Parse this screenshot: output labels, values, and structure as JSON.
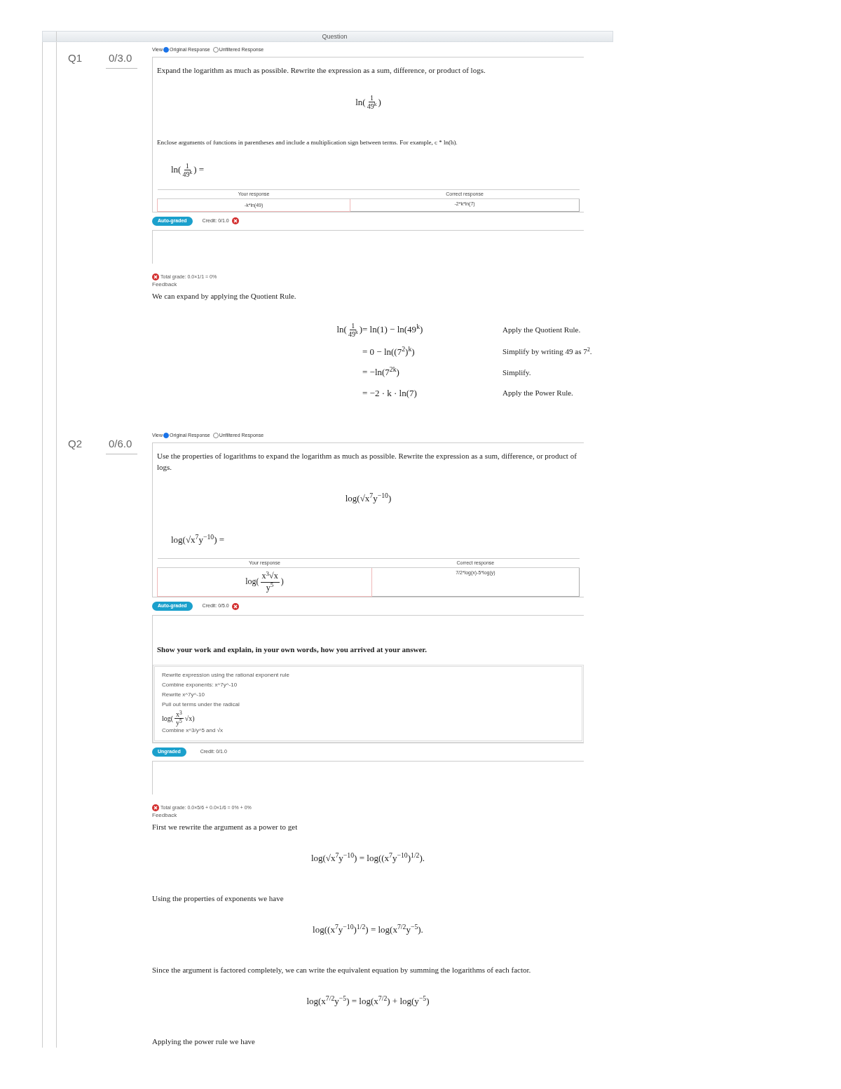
{
  "header": {
    "column": "Question"
  },
  "questions": [
    {
      "label": "Q1",
      "score": "0/3.0",
      "view_label": "View",
      "view_options": [
        {
          "label": "Original Response",
          "selected": true
        },
        {
          "label": "Unfiltered Response",
          "selected": false
        }
      ],
      "prompt": "Expand the logarithm as much as possible. Rewrite the expression as a sum, difference, or product of logs.",
      "display_math": [
        "ln(",
        {
          "num": "1",
          "den": "49$^{k}$"
        },
        ")"
      ],
      "instructions": "Enclose arguments of functions in parentheses and include a multiplication sign between terms. For example, c * ln(h).",
      "answer_math": [
        "ln(",
        {
          "num": "1",
          "den": "49$^{k}$"
        },
        ") ="
      ],
      "response": {
        "headers": [
          "Your response",
          "Correct response"
        ],
        "yours": "-k*ln(49)",
        "correct": "-2*k*ln(7)"
      },
      "grader_badge": "Auto-graded",
      "credit": "Credit: 0/1.0",
      "credit_correct": false,
      "total_grade": "Total grade: 0.0×1/1 = 0%",
      "feedback_label": "Feedback",
      "feedback": [
        {
          "kind": "text",
          "text": "We can expand by applying the Quotient Rule."
        },
        {
          "kind": "steps",
          "rows": [
            {
              "lhs": [
                "ln(",
                {
                  "num": "1",
                  "den": "49$^{k}$"
                },
                ")"
              ],
              "rhs": [
                "= ln(1) − ln(49$^{k}$)"
              ],
              "reason": "Apply the Quotient Rule."
            },
            {
              "lhs": [],
              "rhs": [
                "= 0 − ln((7$^{2}$)$^{k}$)"
              ],
              "reason": "Simplify by writing 49 as 7$^{2}$."
            },
            {
              "lhs": [],
              "rhs": [
                "= −ln(7$^{2k}$)"
              ],
              "reason": "Simplify."
            },
            {
              "lhs": [],
              "rhs": [
                "= −2 · k · ln(7)"
              ],
              "reason": "Apply the Power Rule."
            }
          ]
        }
      ]
    },
    {
      "label": "Q2",
      "score": "0/6.0",
      "view_label": "View",
      "view_options": [
        {
          "label": "Original Response",
          "selected": true
        },
        {
          "label": "Unfiltered Response",
          "selected": false
        }
      ],
      "prompt": "Use the properties of logarithms to expand the logarithm as much as possible. Rewrite the expression as a sum, difference, or product of logs.",
      "display_math": [
        "log(√x$^{7}$y$^{−10}$)"
      ],
      "answer_math": [
        "log(√x$^{7}$y$^{−10}$) ="
      ],
      "response": {
        "headers": [
          "Your response",
          "Correct response"
        ],
        "yours_math": [
          "log(",
          {
            "num": "x$^{3}$√x",
            "den": "y$^{5}$"
          },
          ")"
        ],
        "correct": "7/2*log(x)-5*log(y)"
      },
      "grader_badge": "Auto-graded",
      "credit": "Credit: 0/5.0",
      "credit_correct": false,
      "work": {
        "prompt": "Show your work and explain, in your own words, how you arrived at your answer.",
        "lines": [
          {
            "kind": "text",
            "text": "Rewrite expression using the rational exponent rule"
          },
          {
            "kind": "text",
            "text": "Combine exponents: x^7y^-10"
          },
          {
            "kind": "text",
            "text": "Rewrite x^7y^-10"
          },
          {
            "kind": "text",
            "text": "Pull out terms under the radical"
          },
          {
            "kind": "math",
            "math": [
              "log(",
              {
                "num": "x$^{3}$",
                "den": "y$^{5}$"
              },
              "√x)"
            ]
          },
          {
            "kind": "text",
            "text": "Combine x^3/y^5 and √x"
          }
        ],
        "badge": "Ungraded",
        "credit": "Credit: 0/1.0"
      },
      "total_grade": "Total grade: 0.0×5/6 + 0.0×1/6 = 0% + 0%",
      "feedback_label": "Feedback",
      "feedback": [
        {
          "kind": "text",
          "text": "First we rewrite the argument as a power to get"
        },
        {
          "kind": "math",
          "math": [
            "log(√x$^{7}$y$^{−10}$) = log((x$^{7}$y$^{−10}$)$^{1/2}$)."
          ]
        },
        {
          "kind": "text",
          "text": "Using the properties of exponents we have"
        },
        {
          "kind": "math",
          "math": [
            "log((x$^{7}$y$^{−10}$)$^{1/2}$) = log(x$^{7/2}$y$^{−5}$)."
          ]
        },
        {
          "kind": "text",
          "text": "Since the argument is factored completely, we can write the equivalent equation by summing the logarithms of each factor."
        },
        {
          "kind": "math",
          "math": [
            "log(x$^{7/2}$y$^{−5}$) = log(x$^{7/2}$) + log(y$^{−5}$)"
          ]
        },
        {
          "kind": "text",
          "text": "Applying the power rule we have"
        }
      ]
    }
  ]
}
